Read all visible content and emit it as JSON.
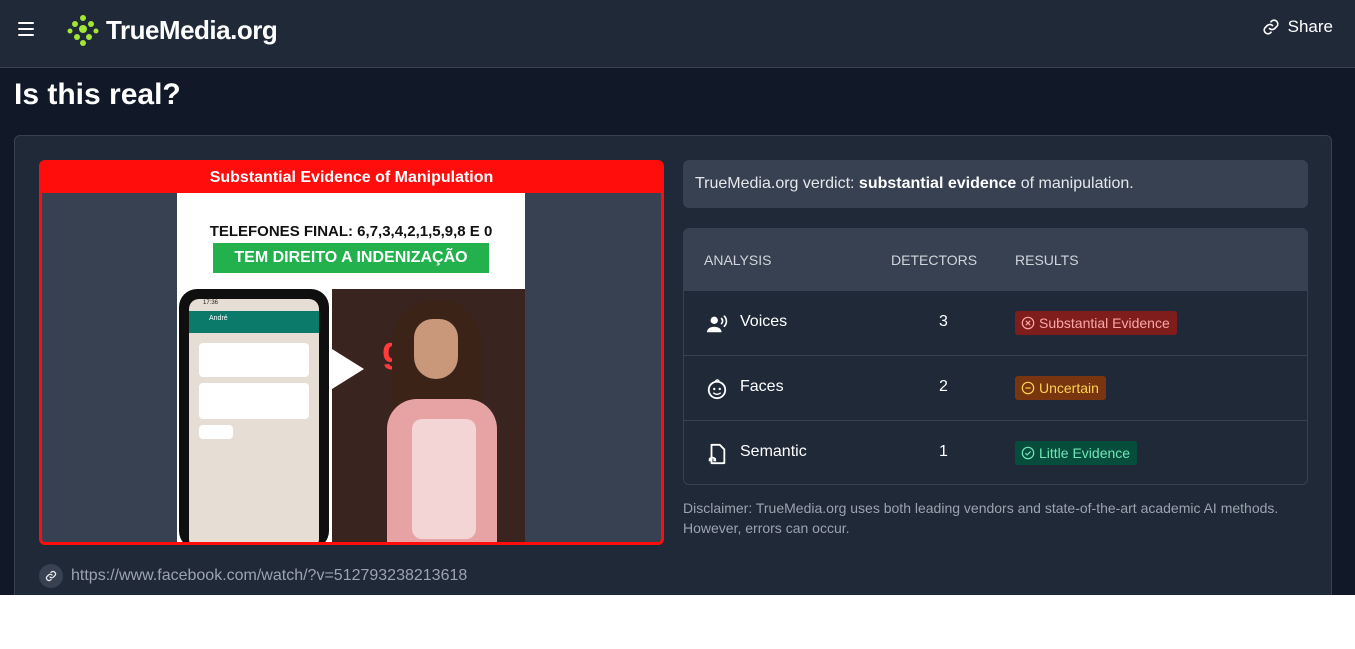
{
  "header": {
    "logo_text": "TrueMedia.org",
    "share_label": "Share"
  },
  "page": {
    "title": "Is this real?"
  },
  "media": {
    "banner": "Substantial Evidence of Manipulation",
    "video_caption_line1": "TELEFONES FINAL: 6,7,3,4,2,1,5,9,8 E 0",
    "video_caption_line2": "TEM DIREITO A INDENIZAÇÃO",
    "phone_time": "17:36",
    "phone_contact": "André",
    "g1_logo": "g1",
    "url": "https://www.facebook.com/watch/?v=512793238213618"
  },
  "verdict": {
    "prefix": "TrueMedia.org verdict: ",
    "emphasis": "substantial evidence",
    "suffix": " of manipulation."
  },
  "analysis_table": {
    "headers": [
      "ANALYSIS",
      "DETECTORS",
      "RESULTS"
    ],
    "rows": [
      {
        "label": "Voices",
        "detectors": "3",
        "result": "Substantial Evidence",
        "icon": "voice-icon",
        "badge_bg": "#7f1d1d",
        "badge_color": "#fca5a5"
      },
      {
        "label": "Faces",
        "detectors": "2",
        "result": "Uncertain",
        "icon": "face-icon",
        "badge_bg": "#78350f",
        "badge_color": "#fcd34d"
      },
      {
        "label": "Semantic",
        "detectors": "1",
        "result": "Little Evidence",
        "icon": "semantic-icon",
        "badge_bg": "#064e3b",
        "badge_color": "#6ee7b7"
      }
    ]
  },
  "disclaimer": "Disclaimer: TrueMedia.org uses both leading vendors and state-of-the-art academic AI methods. However, errors can occur.",
  "colors": {
    "manipulation_red": "#ff0d0d",
    "brand_green": "#a3e635"
  }
}
